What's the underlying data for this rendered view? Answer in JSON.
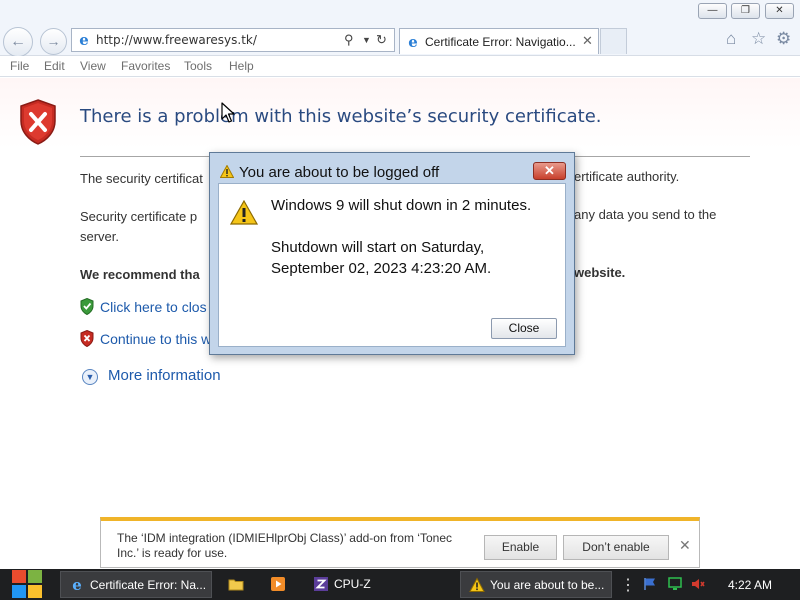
{
  "browser": {
    "address_url": "http://www.freewaresys.tk/",
    "tab_title": "Certificate Error: Navigatio...",
    "window_controls": [
      "minimize",
      "restore",
      "close"
    ],
    "menu": [
      "File",
      "Edit",
      "View",
      "Favorites",
      "Tools",
      "Help"
    ]
  },
  "page": {
    "title": "There is a problem with this website’s security certificate.",
    "paragraph1": "The security certificat",
    "paragraph1_tail": "ertificate authority.",
    "paragraph2": "Security certificate p",
    "paragraph2_line2": "server.",
    "paragraph2_tail": "any data you send to the",
    "recommend": "We recommend tha",
    "recommend_tail": "website.",
    "option_close": "Click here to clos",
    "option_continue": "Continue to this w",
    "more_info": "More information"
  },
  "dialog": {
    "title": "You are about to be logged off",
    "message": "Windows 9 will shut down in 2 minutes.",
    "detail": " Shutdown will start on Saturday,\nSeptember 02, 2023 4:23:20 AM.",
    "close_button": "Close"
  },
  "notification": {
    "text": "The ‘IDM integration (IDMIEHlprObj Class)’ add-on from ‘Tonec Inc.’ is ready for use.",
    "enable_button": "Enable",
    "dont_enable_button": "Don’t enable"
  },
  "taskbar": {
    "items": [
      {
        "label": "Certificate Error: Na...",
        "icon": "ie-icon"
      },
      {
        "label": "",
        "icon": "folder-icon"
      },
      {
        "label": "",
        "icon": "media-player-icon"
      },
      {
        "label": "CPU-Z",
        "icon": "cpuz-icon"
      },
      {
        "label": "You are about to be...",
        "icon": "warning-icon"
      }
    ],
    "clock": "4:22 AM"
  },
  "colors": {
    "link": "#1d5aab",
    "title": "#2a4a80",
    "notification_accent": "#f0b429",
    "taskbar": "#1e1f21"
  }
}
